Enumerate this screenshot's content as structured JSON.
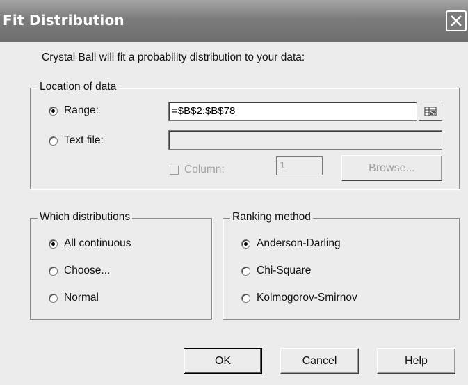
{
  "window": {
    "title": "Fit Distribution",
    "close_icon": "close-icon"
  },
  "intro_text": "Crystal Ball will fit a probability distribution to your data:",
  "location_group": {
    "legend": "Location of data",
    "range_label": "Range:",
    "range_value": "=$B$2:$B$78",
    "range_selected": true,
    "textfile_label": "Text file:",
    "textfile_value": "",
    "column_label": "Column:",
    "column_value": "1",
    "browse_label": "Browse..."
  },
  "distributions_group": {
    "legend": "Which distributions",
    "options": [
      "All continuous",
      "Choose...",
      "Normal"
    ],
    "selected_index": 0
  },
  "ranking_group": {
    "legend": "Ranking method",
    "options": [
      "Anderson-Darling",
      "Chi-Square",
      "Kolmogorov-Smirnov"
    ],
    "selected_index": 0
  },
  "buttons": {
    "ok": "OK",
    "cancel": "Cancel",
    "help": "Help"
  }
}
